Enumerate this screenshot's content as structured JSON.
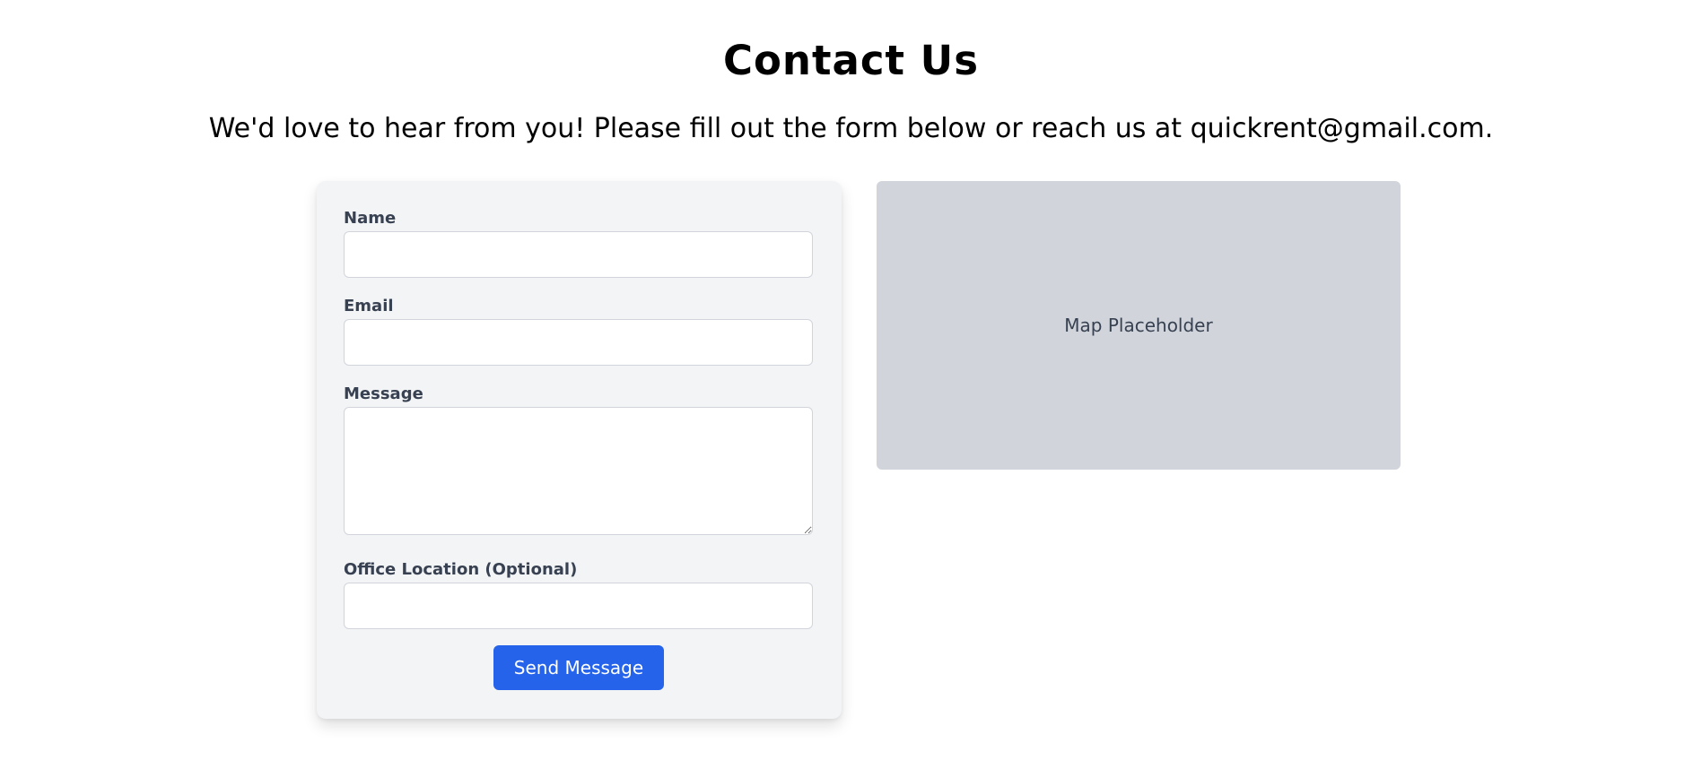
{
  "header": {
    "title": "Contact Us",
    "subtitle": "We'd love to hear from you! Please fill out the form below or reach us at quickrent@gmail.com."
  },
  "form": {
    "name_label": "Name",
    "name_value": "",
    "email_label": "Email",
    "email_value": "",
    "message_label": "Message",
    "message_value": "",
    "office_label": "Office Location (Optional)",
    "office_value": "",
    "submit_label": "Send Message"
  },
  "map": {
    "label": "Map Placeholder"
  },
  "colors": {
    "primary_button": "#2563eb",
    "card_background": "#f3f4f6",
    "map_background": "#d1d5db"
  }
}
